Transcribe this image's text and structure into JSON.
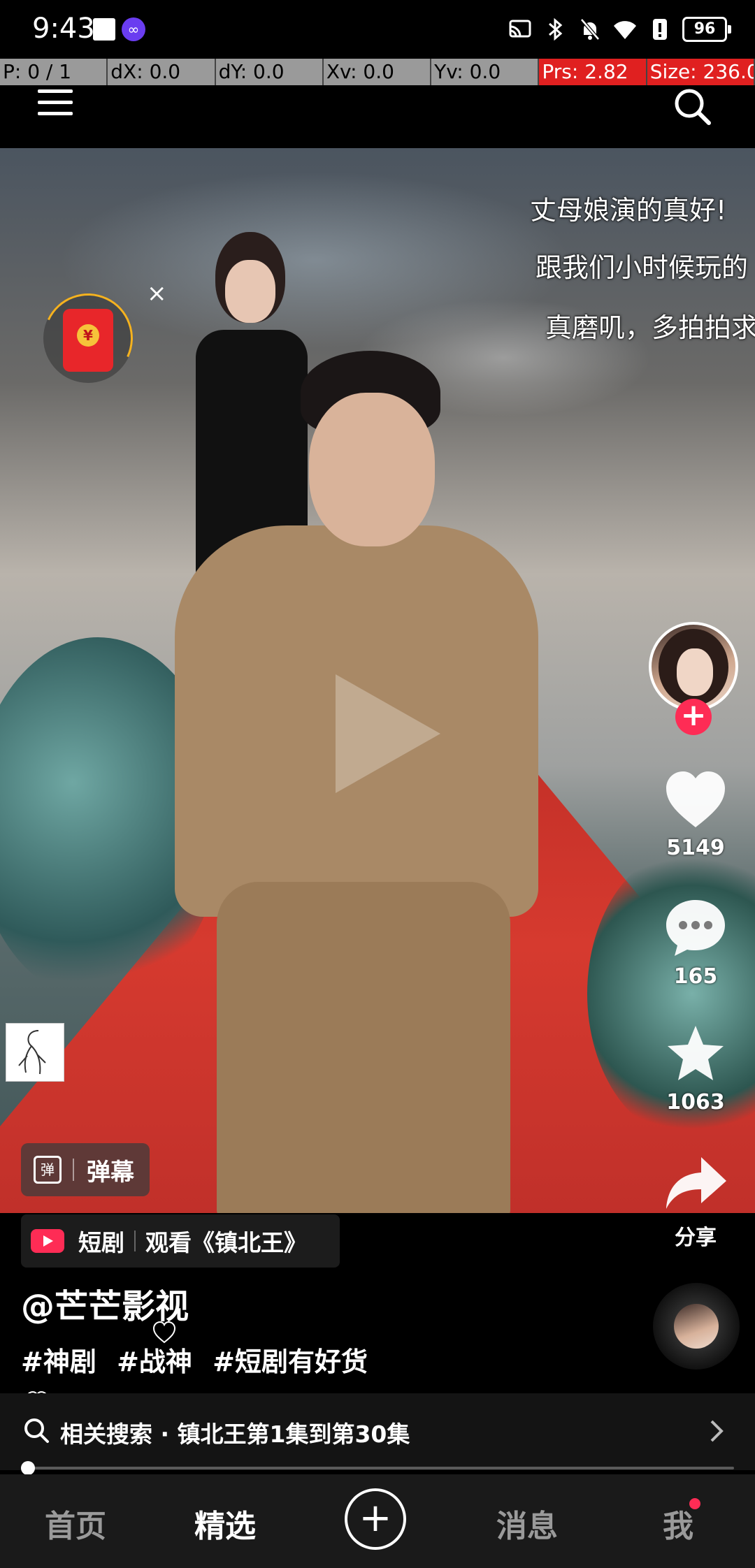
{
  "status_bar": {
    "time": "9:43",
    "battery": "96",
    "app_icon_glyph": "∞",
    "icons": [
      "cast-icon",
      "bluetooth-icon",
      "bell-muted-icon",
      "wifi-icon",
      "alert-icon",
      "battery-icon"
    ]
  },
  "debug_bar": {
    "pointer": "P: 0 / 1",
    "dx": "dX: 0.0",
    "dy": "dY: 0.0",
    "xv": "Xv: 0.0",
    "yv": "Yv: 0.0",
    "prs": "Prs: 2.82",
    "size": "Size: 236.0"
  },
  "danmu": [
    "丈母娘演的真好!",
    "跟我们小时候玩的",
    "真磨叽，多拍拍求"
  ],
  "red_packet": {
    "coin_glyph": "¥",
    "close_glyph": "×"
  },
  "danmu_toggle": {
    "icon_glyph": "弹",
    "label": "弹幕"
  },
  "actions": {
    "follow_glyph": "+",
    "like_count": "5149",
    "comment_count": "165",
    "favorite_count": "1063",
    "share_label": "分享"
  },
  "drama": {
    "category": "短剧",
    "watch_text": "观看《镇北王》"
  },
  "author": "@芒芒影视",
  "hashtags": [
    "#神剧",
    "#战神",
    "#短剧有好货"
  ],
  "related_search": "相关搜索 · 镇北王第1集到第30集",
  "progress": {
    "fraction": 0.0
  },
  "nav": {
    "home": "首页",
    "featured": "精选",
    "add": "+",
    "messages": "消息",
    "me": "我"
  },
  "colors": {
    "accent": "#fe2c55",
    "debug_alert": "#e02020",
    "debug_bg": "#9a9a9a",
    "red_packet": "#e8262a"
  }
}
